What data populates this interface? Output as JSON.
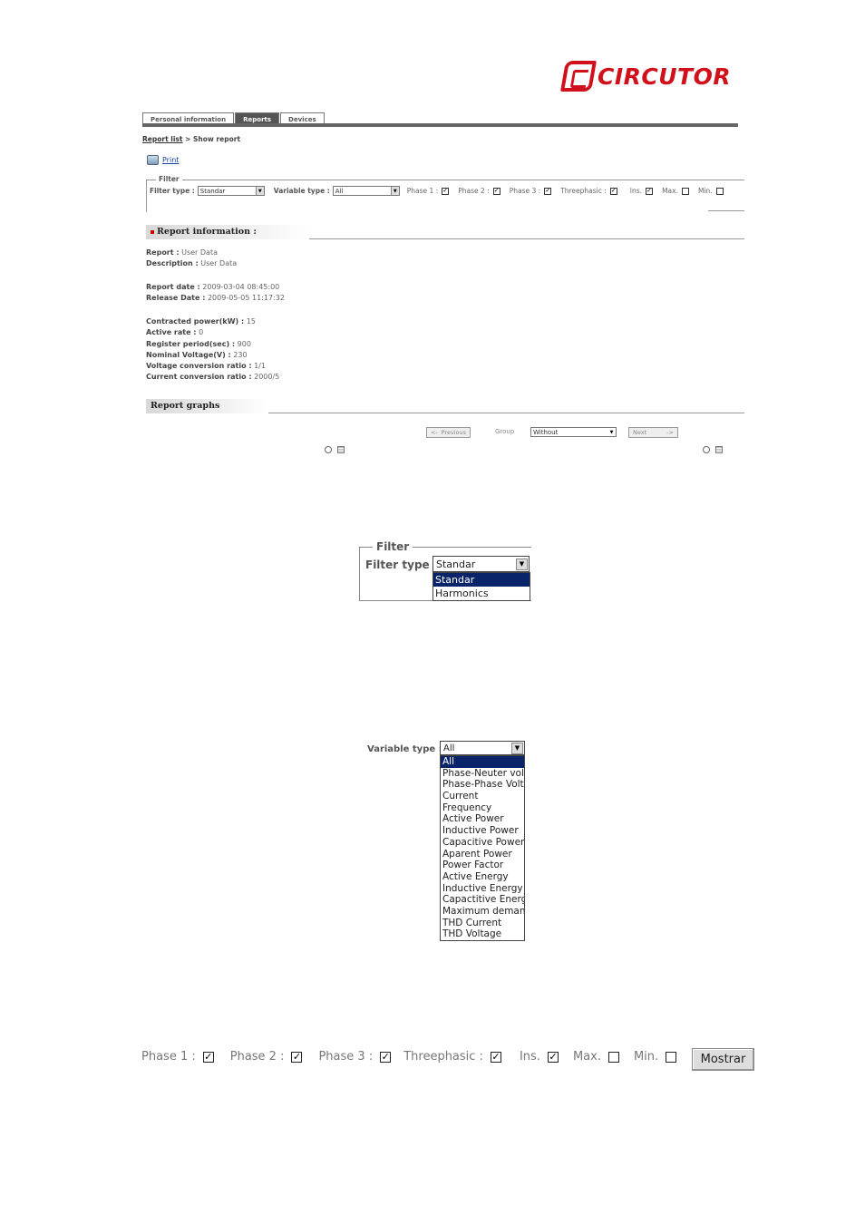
{
  "brand": {
    "name": "CIRCUTOR",
    "color": "#d0111b"
  },
  "tabs": [
    {
      "label": "Personal information",
      "active": false
    },
    {
      "label": "Reports",
      "active": true
    },
    {
      "label": "Devices",
      "active": false
    }
  ],
  "breadcrumb": {
    "link": "Report list",
    "separator": " > ",
    "current": "Show report"
  },
  "print": {
    "label": "Print",
    "icon": "printer-icon"
  },
  "filter": {
    "legend": "Filter",
    "filter_type_label": "Filter type :",
    "filter_type_value": "Standar",
    "variable_type_label": "Variable type :",
    "variable_type_value": "All",
    "phase1": {
      "label": "Phase 1 :",
      "checked": true
    },
    "phase2": {
      "label": "Phase 2 :",
      "checked": true
    },
    "phase3": {
      "label": "Phase 3 :",
      "checked": true
    },
    "threephasic": {
      "label": "Threephasic :",
      "checked": true
    },
    "ins": {
      "label": "Ins.",
      "checked": true
    },
    "max": {
      "label": "Max.",
      "checked": false
    },
    "min": {
      "label": "Min.",
      "checked": false
    }
  },
  "report_info": {
    "heading": "Report information :",
    "report": {
      "label": "Report :",
      "value": "User Data"
    },
    "description": {
      "label": "Description :",
      "value": "User Data"
    },
    "report_date": {
      "label": "Report date :",
      "value": "2009-03-04 08:45:00"
    },
    "release_date": {
      "label": "Release Date :",
      "value": "2009-05-05 11:17:32"
    },
    "contracted_power": {
      "label": "Contracted power(kW) :",
      "value": "15"
    },
    "active_rate": {
      "label": "Active rate :",
      "value": "0"
    },
    "register_period": {
      "label": "Register period(sec) :",
      "value": "900"
    },
    "nominal_voltage": {
      "label": "Nominal Voltage(V) :",
      "value": "230"
    },
    "voltage_ratio": {
      "label": "Voltage conversion ratio :",
      "value": "1/1"
    },
    "current_ratio": {
      "label": "Current conversion ratio :",
      "value": "2000/5"
    }
  },
  "report_graphs": {
    "heading": "Report graphs",
    "previous_label": "Previous",
    "previous_glyph": "<-",
    "group_label": "Group",
    "group_value": "Without",
    "next_label": "Next",
    "next_glyph": "->"
  },
  "filter_zoom": {
    "legend": "Filter",
    "label": "Filter type :",
    "value": "Standar",
    "options": [
      "Standar",
      "Harmonics"
    ],
    "selected_index": 0
  },
  "variable_zoom": {
    "label": "Variable type :",
    "value": "All",
    "options": [
      "All",
      "Phase-Neuter voltag",
      "Phase-Phase Voltag",
      "Current",
      "Frequency",
      "Active Power",
      "Inductive Power",
      "Capacitive Power",
      "Aparent Power",
      "Power Factor",
      "Active Energy",
      "Inductive Energy",
      "Capactitive Energy",
      "Maximum demand",
      "THD Current",
      "THD Voltage"
    ],
    "selected_index": 0
  },
  "phase_zoom": {
    "phase1": "Phase 1 :",
    "phase2": "Phase 2 :",
    "phase3": "Phase 3 :",
    "threephasic": "Threephasic :",
    "ins": "Ins.",
    "max": "Max.",
    "min": "Min.",
    "show_button": "Mostrar"
  },
  "check_glyph": "✓"
}
